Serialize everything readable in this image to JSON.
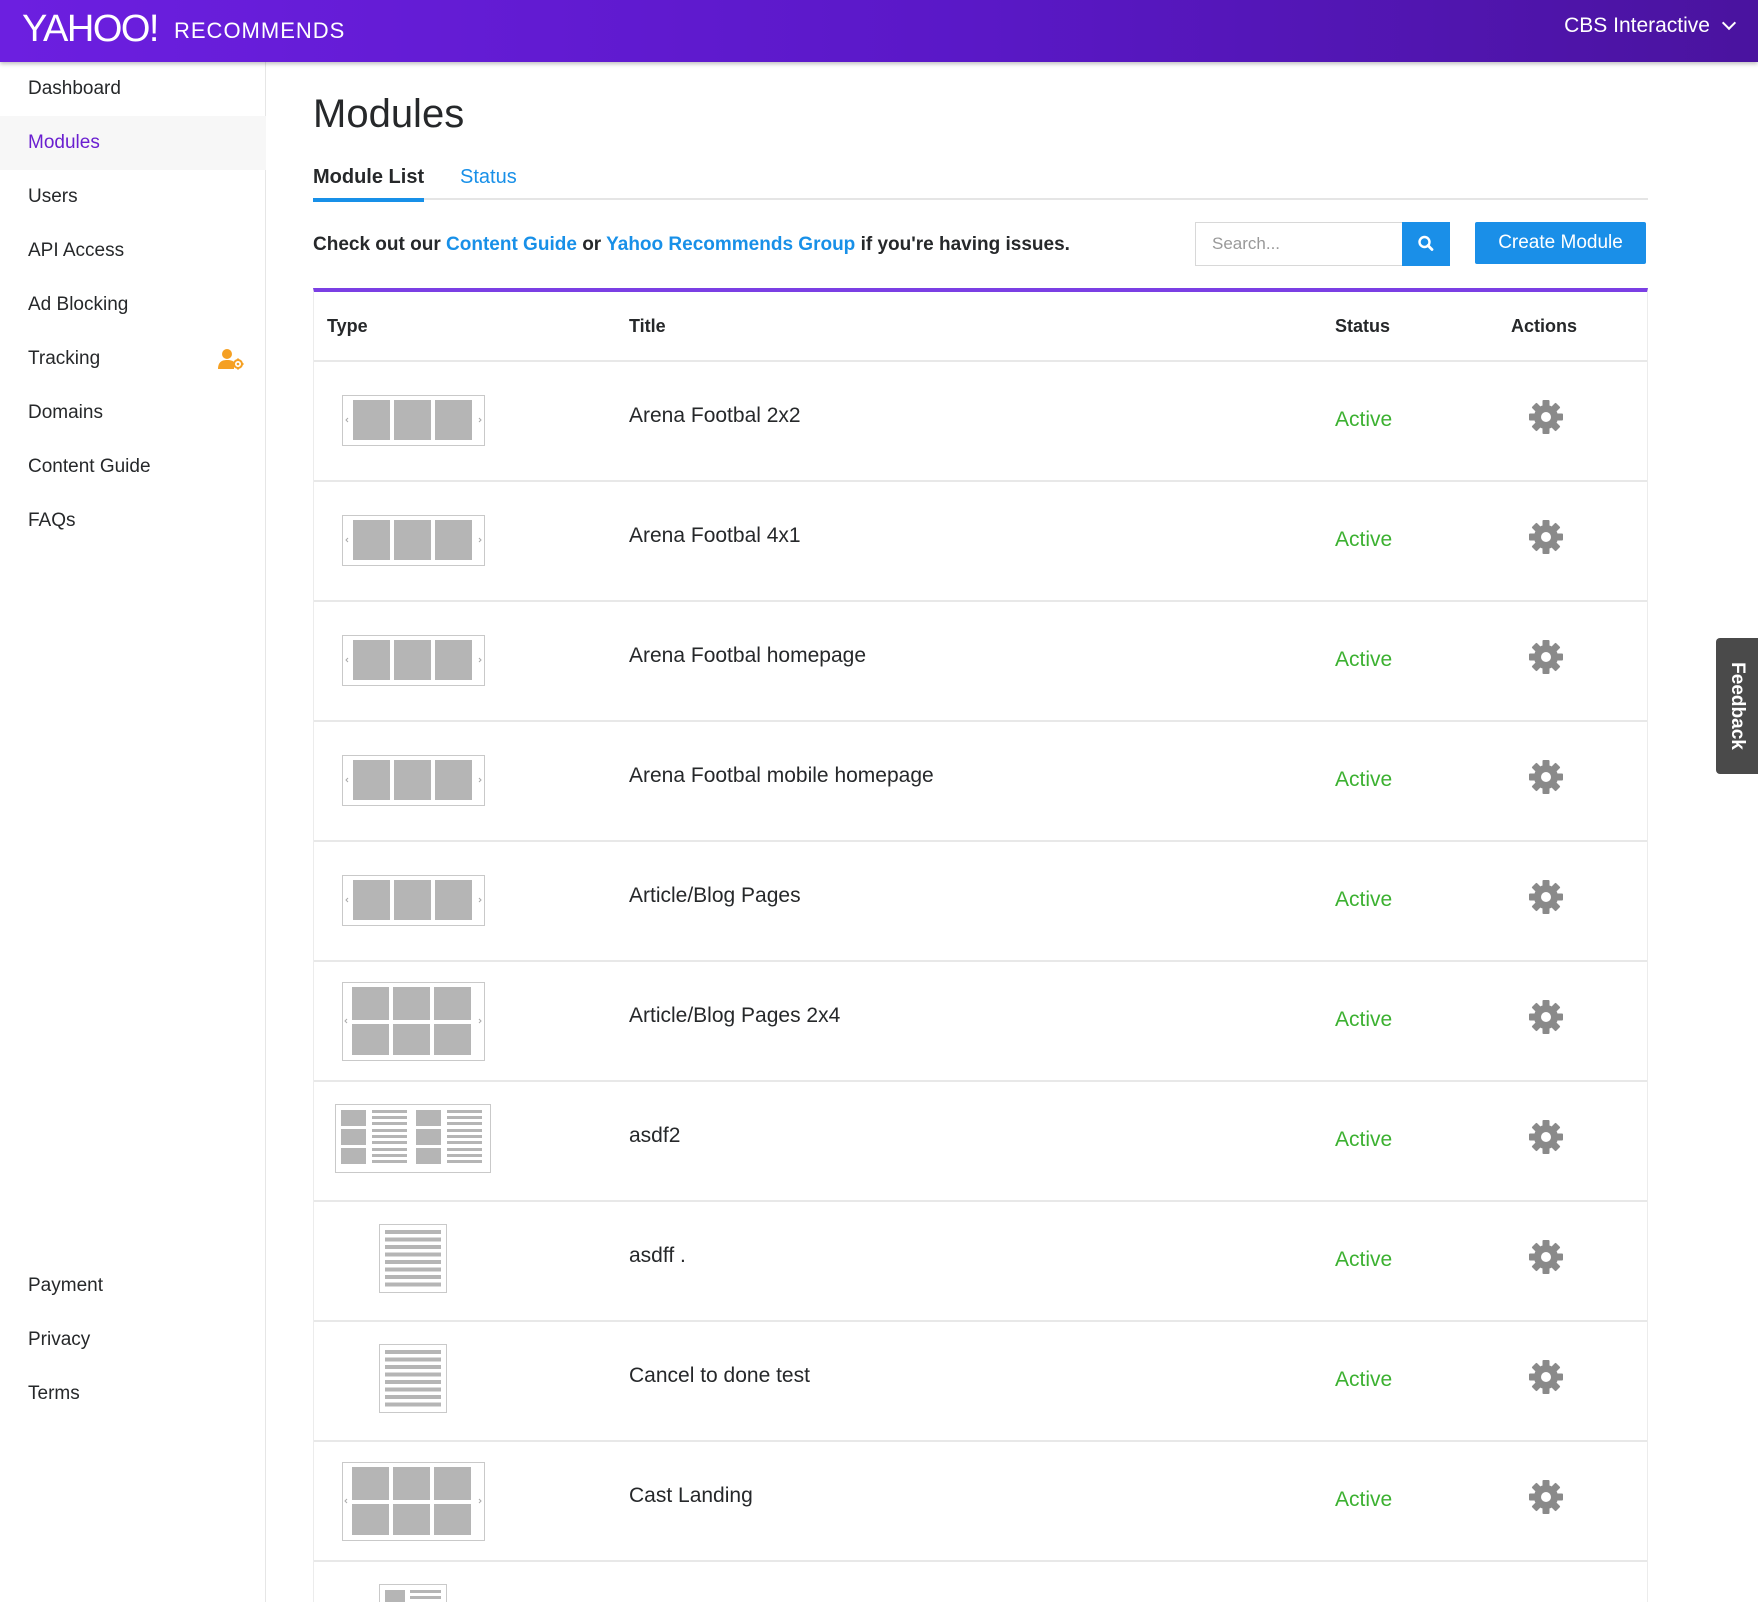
{
  "header": {
    "logo": "YAHOO!",
    "product": "RECOMMENDS",
    "account": "CBS Interactive"
  },
  "sidebar": {
    "items": [
      {
        "label": "Dashboard"
      },
      {
        "label": "Modules",
        "active": true
      },
      {
        "label": "Users"
      },
      {
        "label": "API Access"
      },
      {
        "label": "Ad Blocking"
      },
      {
        "label": "Tracking",
        "icon": "user-settings-icon"
      },
      {
        "label": "Domains"
      },
      {
        "label": "Content Guide"
      },
      {
        "label": "FAQs"
      }
    ],
    "footer_items": [
      {
        "label": "Payment"
      },
      {
        "label": "Privacy"
      },
      {
        "label": "Terms"
      }
    ]
  },
  "page": {
    "title": "Modules",
    "tabs": [
      {
        "label": "Module List",
        "active": true
      },
      {
        "label": "Status"
      }
    ],
    "help": {
      "prefix": "Check out our",
      "link1": "Content Guide",
      "middle": "or",
      "link2": "Yahoo Recommends Group",
      "suffix": "if you're having issues."
    },
    "search": {
      "placeholder": "Search..."
    },
    "create_button": "Create Module"
  },
  "table": {
    "columns": [
      "Type",
      "Title",
      "Status",
      "Actions"
    ],
    "rows": [
      {
        "type": "carousel-1x3",
        "title": "Arena Footbal 2x2",
        "status": "Active"
      },
      {
        "type": "carousel-1x3",
        "title": "Arena Footbal 4x1",
        "status": "Active"
      },
      {
        "type": "carousel-1x3",
        "title": "Arena Footbal homepage",
        "status": "Active"
      },
      {
        "type": "carousel-1x3",
        "title": "Arena Footbal mobile homepage",
        "status": "Active"
      },
      {
        "type": "carousel-1x3",
        "title": "Article/Blog Pages",
        "status": "Active"
      },
      {
        "type": "carousel-2x3",
        "title": "Article/Blog Pages 2x4",
        "status": "Active"
      },
      {
        "type": "grid-list",
        "title": "asdf2",
        "status": "Active"
      },
      {
        "type": "text-list",
        "title": "asdff .",
        "status": "Active"
      },
      {
        "type": "text-list",
        "title": "Cancel to done test",
        "status": "Active"
      },
      {
        "type": "carousel-2x3",
        "title": "Cast Landing",
        "status": "Active"
      },
      {
        "type": "thumb-list",
        "title": "",
        "status": ""
      }
    ]
  },
  "feedback": "Feedback",
  "colors": {
    "header_purple": "#6c1fe0",
    "active_nav": "#6a1fd0",
    "link_blue": "#1890e8",
    "button_blue": "#1a8fe8",
    "status_green": "#3cb131",
    "table_accent": "#7b3fe4"
  }
}
